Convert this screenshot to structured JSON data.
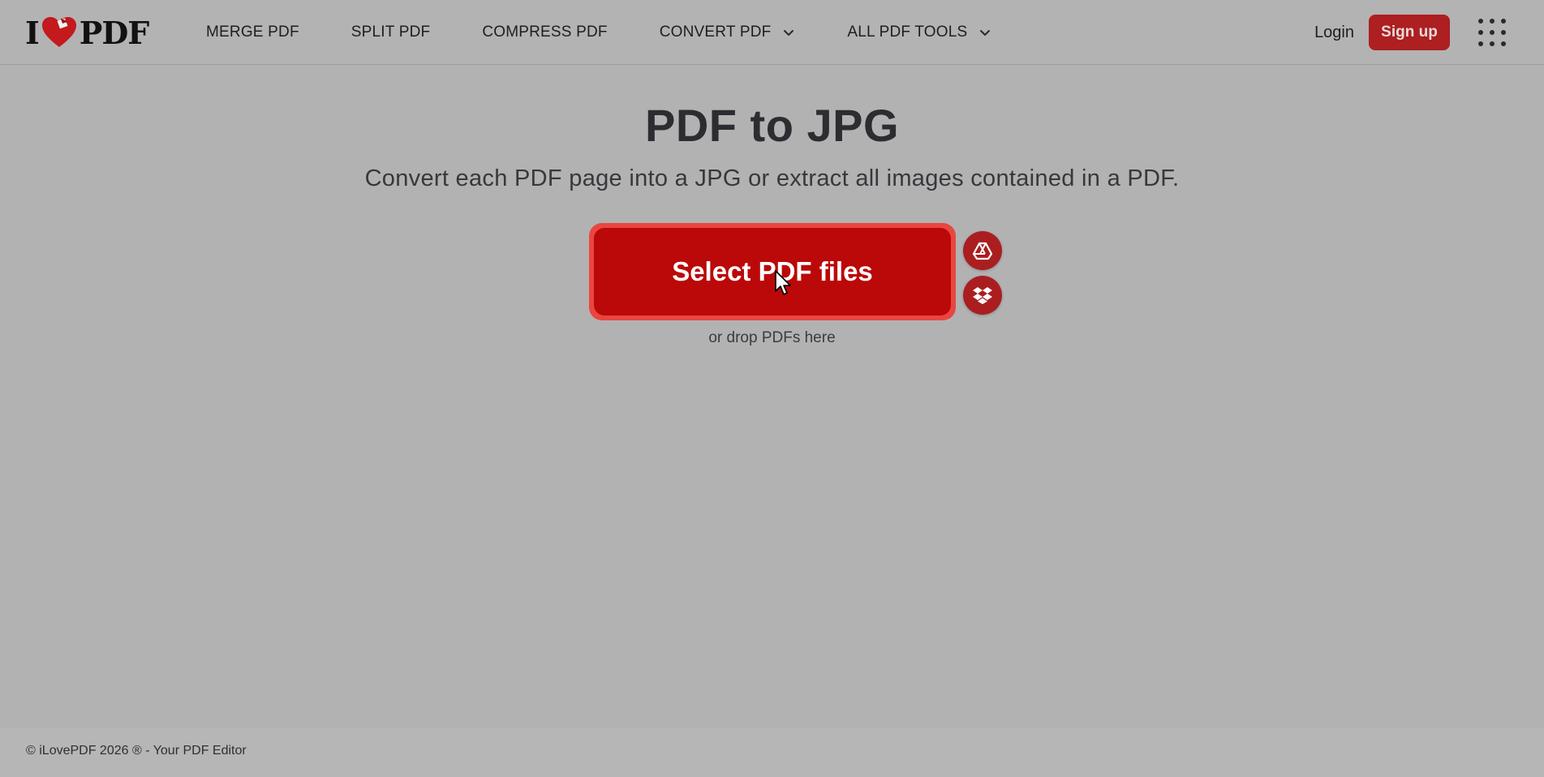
{
  "header": {
    "logo_left": "I",
    "logo_right": "PDF",
    "nav": [
      {
        "label": "MERGE PDF"
      },
      {
        "label": "SPLIT PDF"
      },
      {
        "label": "COMPRESS PDF"
      },
      {
        "label": "CONVERT PDF"
      },
      {
        "label": "ALL PDF TOOLS"
      }
    ],
    "login_label": "Login",
    "signup_label": "Sign up"
  },
  "main": {
    "title": "PDF to JPG",
    "subtitle": "Convert each PDF page into a JPG or extract all images contained in a PDF.",
    "select_label": "Select PDF files",
    "drop_hint": "or drop PDFs here",
    "icons": [
      "google-drive-icon",
      "dropbox-icon"
    ]
  },
  "footer": {
    "text": "© iLovePDF 2026 ® - Your PDF Editor"
  },
  "colors": {
    "brand_red": "#bb0809",
    "accent_red": "#ad1f21",
    "background": "#b2b2b3"
  }
}
